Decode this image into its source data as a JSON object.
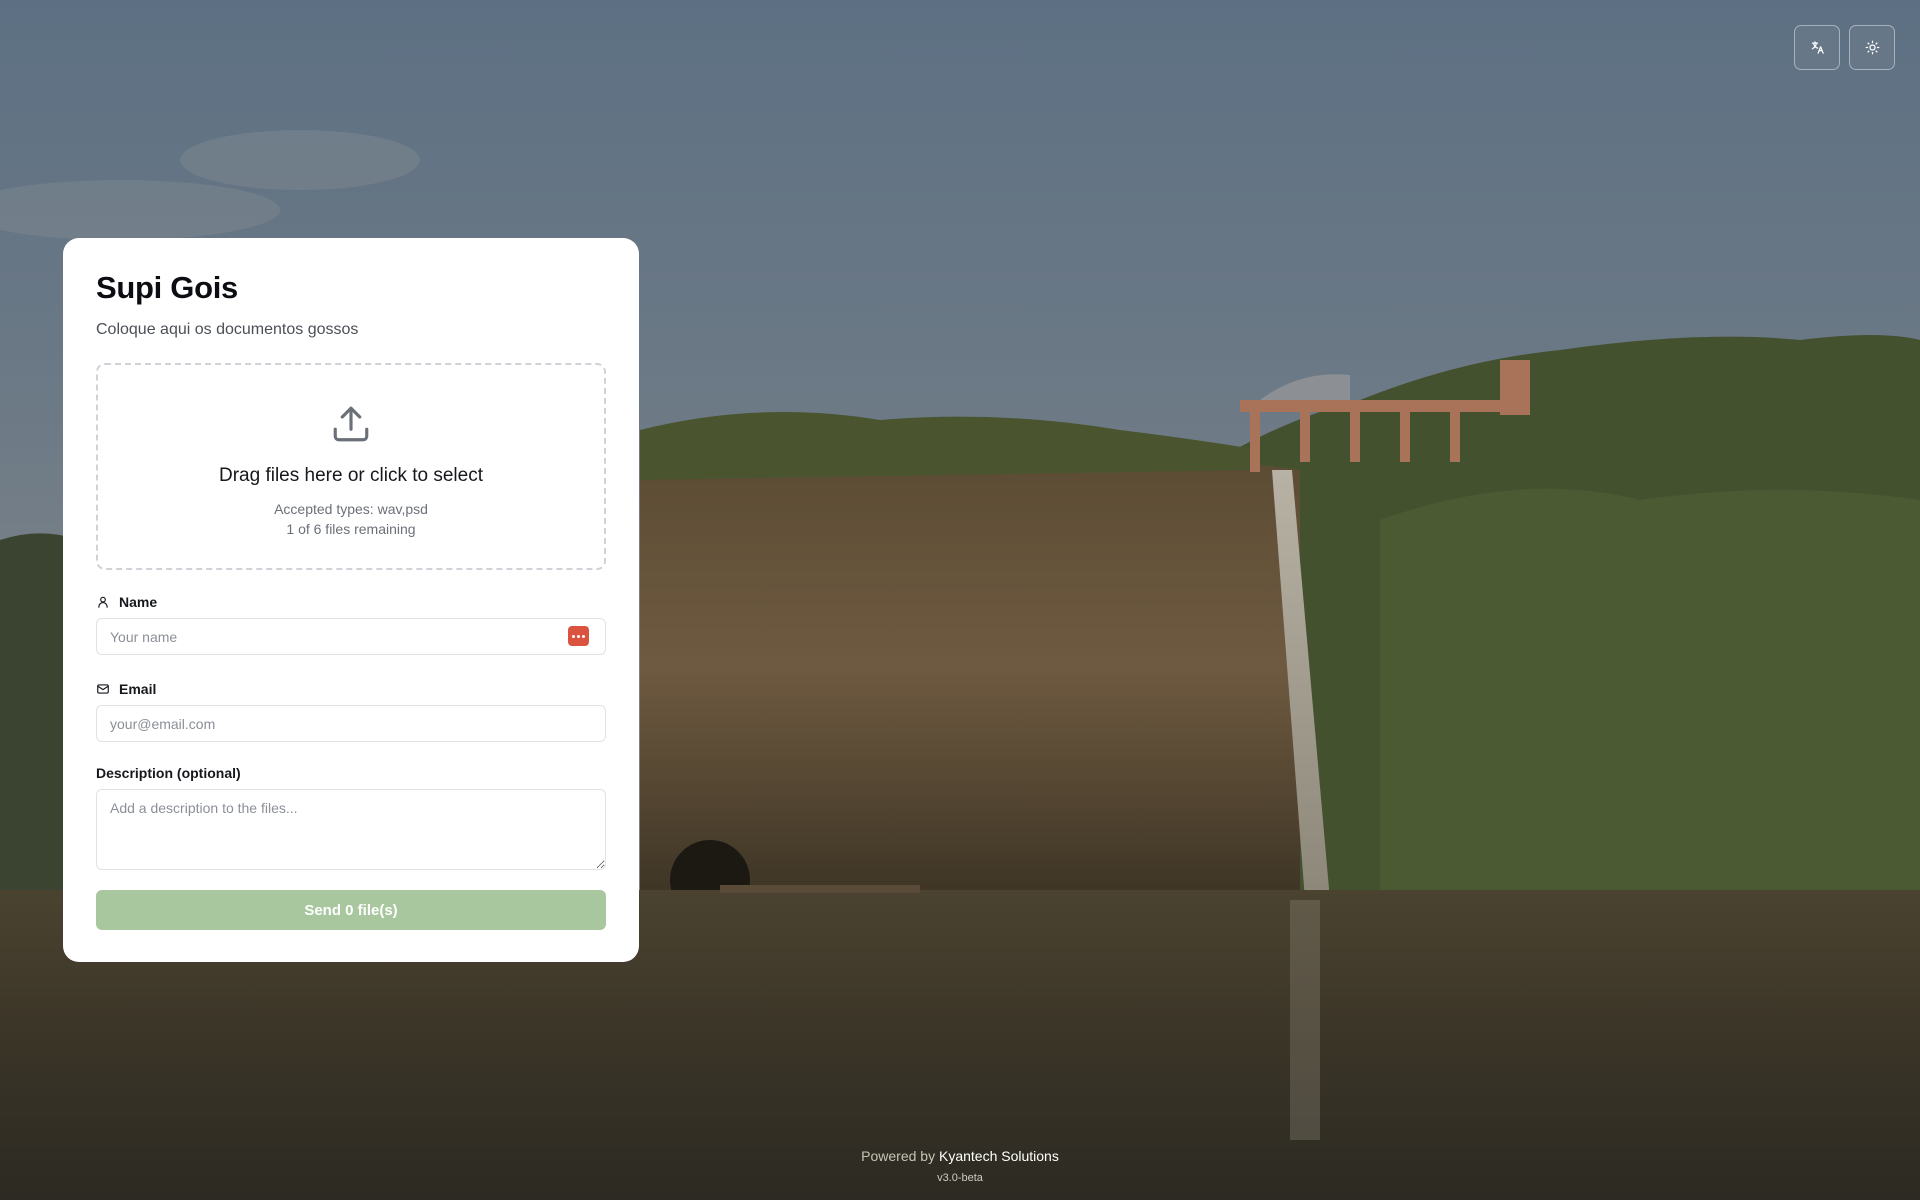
{
  "header_controls": {
    "language_icon": "translate-icon",
    "theme_icon": "sun-icon"
  },
  "card": {
    "title": "Supi Gois",
    "subtitle": "Coloque aqui os documentos gossos"
  },
  "dropzone": {
    "icon": "upload-icon",
    "prompt": "Drag files here or click to select",
    "accepted_types": "Accepted types: wav,psd",
    "files_remaining": "1 of 6 files remaining"
  },
  "form": {
    "name_label": "Name",
    "name_placeholder": "Your name",
    "email_label": "Email",
    "email_placeholder": "your@email.com",
    "description_label": "Description (optional)",
    "description_placeholder": "Add a description to the files...",
    "submit_label": "Send 0 file(s)"
  },
  "footer": {
    "powered_prefix": "Powered by",
    "brand": "Kyantech Solutions",
    "version": "v3.0-beta"
  },
  "colors": {
    "submit_button": "#a8c79e",
    "password_manager_badge": "#d9533e",
    "card_background": "#ffffff"
  }
}
